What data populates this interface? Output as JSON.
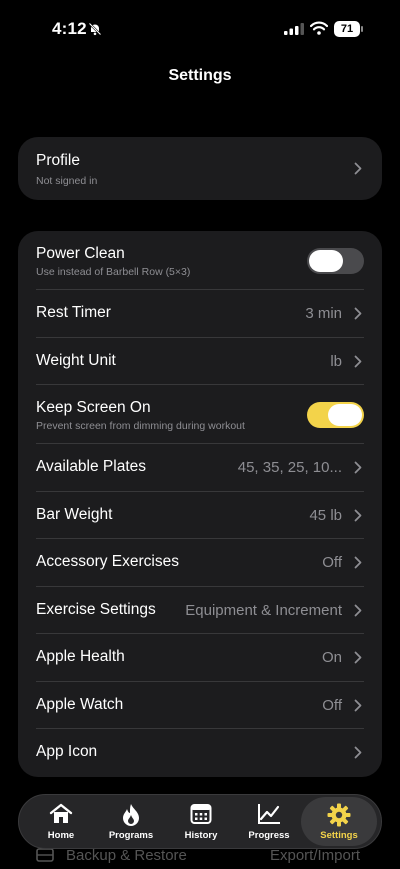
{
  "status_bar": {
    "time": "4:12",
    "battery": "71"
  },
  "header": {
    "title": "Settings"
  },
  "profile": {
    "title": "Profile",
    "subtitle": "Not signed in"
  },
  "settings": {
    "power_clean": {
      "title": "Power Clean",
      "subtitle": "Use instead of Barbell Row (5×3)",
      "enabled": false
    },
    "rest_timer": {
      "title": "Rest Timer",
      "value": "3 min"
    },
    "weight_unit": {
      "title": "Weight Unit",
      "value": "lb"
    },
    "keep_screen_on": {
      "title": "Keep Screen On",
      "subtitle": "Prevent screen from dimming during workout",
      "enabled": true
    },
    "available_plates": {
      "title": "Available Plates",
      "value": "45, 35, 25, 10..."
    },
    "bar_weight": {
      "title": "Bar Weight",
      "value": "45 lb"
    },
    "accessory_exercises": {
      "title": "Accessory Exercises",
      "value": "Off"
    },
    "exercise_settings": {
      "title": "Exercise Settings",
      "value": "Equipment & Increment"
    },
    "apple_health": {
      "title": "Apple Health",
      "value": "On"
    },
    "apple_watch": {
      "title": "Apple Watch",
      "value": "Off"
    },
    "app_icon": {
      "title": "App Icon"
    }
  },
  "backup": {
    "title": "Backup & Restore",
    "value": "Export/Import"
  },
  "tabbar": {
    "tabs": [
      {
        "label": "Home",
        "icon": "home-icon"
      },
      {
        "label": "Programs",
        "icon": "flame-icon"
      },
      {
        "label": "History",
        "icon": "calendar-icon"
      },
      {
        "label": "Progress",
        "icon": "chart-icon"
      },
      {
        "label": "Settings",
        "icon": "gear-icon",
        "active": true
      }
    ]
  },
  "colors": {
    "accent": "#f3d34a",
    "background": "#000000",
    "card": "#1c1c1e",
    "secondary_text": "#8e8e93"
  }
}
